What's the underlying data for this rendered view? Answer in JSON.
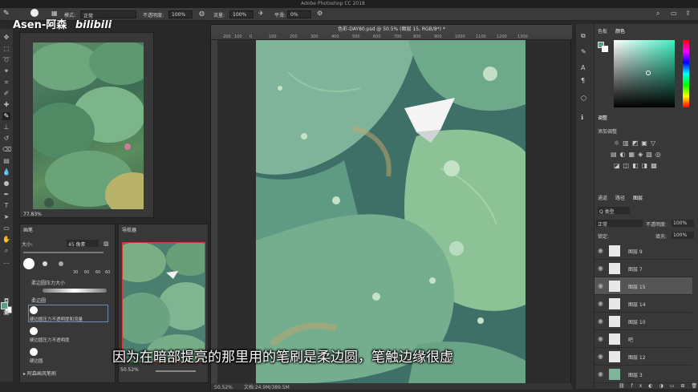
{
  "window": {
    "title": "Adobe Photoshop CC 2018"
  },
  "watermark": {
    "author": "Asen-阿森",
    "logo": "bilibili"
  },
  "options_bar": {
    "mode_label": "模式:",
    "mode_value": "正常",
    "opacity_label": "不透明度:",
    "opacity_value": "100%",
    "flow_label": "流量:",
    "flow_value": "100%",
    "smooth_label": "平滑:",
    "smooth_value": "0%"
  },
  "reference": {
    "zoom": "77.83%"
  },
  "brush_panel": {
    "tab": "画笔",
    "size_label": "大小:",
    "size_value": "45 像素",
    "presets": [
      "柔边圆压力大小",
      "柔边圆",
      "硬边圆压力不透明度和流量",
      "硬边圆压力不透明度",
      "硬边圆"
    ],
    "sizes": [
      "30",
      "60",
      "60",
      "60"
    ],
    "group": "阿森画风笔刷"
  },
  "navigator": {
    "tab": "导航器",
    "zoom": "50.52%"
  },
  "document": {
    "tab_title": "色彩-DAY80.psd @ 50.5% (图层 15, RGB/8*) *",
    "status_zoom": "50.52%",
    "status_doc": "文档:24.9M/389.5M",
    "ruler_marks": [
      "200",
      "100",
      "0",
      "100",
      "200",
      "300",
      "400",
      "500",
      "600",
      "700",
      "800",
      "900",
      "1000",
      "1100",
      "1200",
      "1300"
    ]
  },
  "right_panel": {
    "color_tabs": [
      "色板",
      "颜色"
    ],
    "adjust_tab": "调整",
    "adjust_label": "添加调整",
    "layer_tabs": [
      "通道",
      "路径",
      "图层"
    ],
    "kind_label": "Q 类型",
    "blend_value": "正常",
    "opacity_label": "不透明度:",
    "opacity_value": "100%",
    "lock_label": "锁定:",
    "fill_label": "填充:",
    "fill_value": "100%",
    "layers": [
      {
        "name": "图层 9"
      },
      {
        "name": "图层 7"
      },
      {
        "name": "图层 15"
      },
      {
        "name": "图层 14"
      },
      {
        "name": "图层 10"
      },
      {
        "name": "吧"
      },
      {
        "name": "图层 12"
      },
      {
        "name": "图层 3"
      }
    ]
  },
  "subtitle": "因为在暗部提亮的那里用的笔刷是柔边圆，笔触边缘很虚",
  "colors": {
    "foreground": "#5a9c86",
    "background": "#ffffff"
  }
}
